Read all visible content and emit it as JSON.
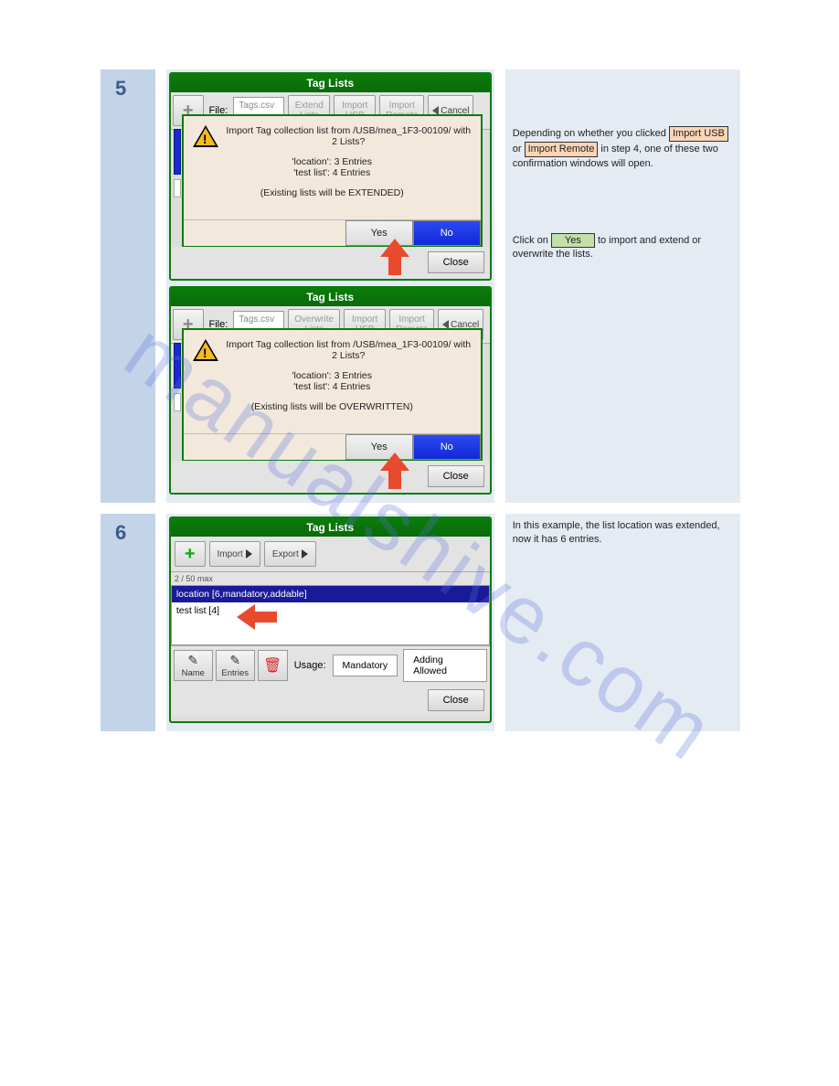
{
  "watermark": "manualshive.com",
  "step5": {
    "number": "5",
    "screenA": {
      "title": "Tag Lists",
      "file_label": "File:",
      "file_input": "Tags.csv",
      "extend_btn_l1": "Extend",
      "extend_btn_l2": "Lists",
      "import_usb_l1": "Import",
      "import_usb_l2": "USB",
      "import_remote_l1": "Import",
      "import_remote_l2": "Remote",
      "cancel": "Cancel",
      "dlg_line1": "Import Tag collection list from /USB/mea_1F3-00109/ with 2 Lists?",
      "dlg_line2": "'location': 3 Entries",
      "dlg_line3": "'test list': 4 Entries",
      "dlg_line4": "(Existing lists will be EXTENDED)",
      "yes": "Yes",
      "no": "No",
      "close": "Close"
    },
    "screenB": {
      "title": "Tag Lists",
      "file_label": "File:",
      "file_input": "Tags.csv",
      "overwrite_btn_l1": "Overwrite",
      "overwrite_btn_l2": "Lists",
      "import_usb_l1": "Import",
      "import_usb_l2": "USB",
      "import_remote_l1": "Import",
      "import_remote_l2": "Remote",
      "cancel": "Cancel",
      "dlg_line1": "Import Tag collection list from /USB/mea_1F3-00109/ with 2 Lists?",
      "dlg_line2": "'location': 3 Entries",
      "dlg_line3": "'test list': 4 Entries",
      "dlg_line4": "(Existing lists will be OVERWRITTEN)",
      "yes": "Yes",
      "no": "No",
      "close": "Close"
    },
    "text": {
      "p1a": "Depending on whether you clicked ",
      "hl1": "Import USB",
      "p1b": " or ",
      "hl2": "Import Remote",
      "p1c": " in step 4, one of these two confirmation windows will open.",
      "p2a": "Click on ",
      "hl3": "Yes",
      "p2b": " to import and extend or overwrite the lists."
    }
  },
  "step6": {
    "number": "6",
    "screen": {
      "title": "Tag Lists",
      "import_btn": "Import",
      "export_btn": "Export",
      "count": "2 / 50 max",
      "row1": "location [6,mandatory,addable]",
      "row2": "test list [4]",
      "name_btn": "Name",
      "entries_btn": "Entries",
      "usage_label": "Usage:",
      "mandatory_btn": "Mandatory",
      "adding_btn": "Adding Allowed",
      "close": "Close"
    },
    "text": {
      "p1": "In this example, the list location was extended, now it has 6 entries."
    }
  }
}
